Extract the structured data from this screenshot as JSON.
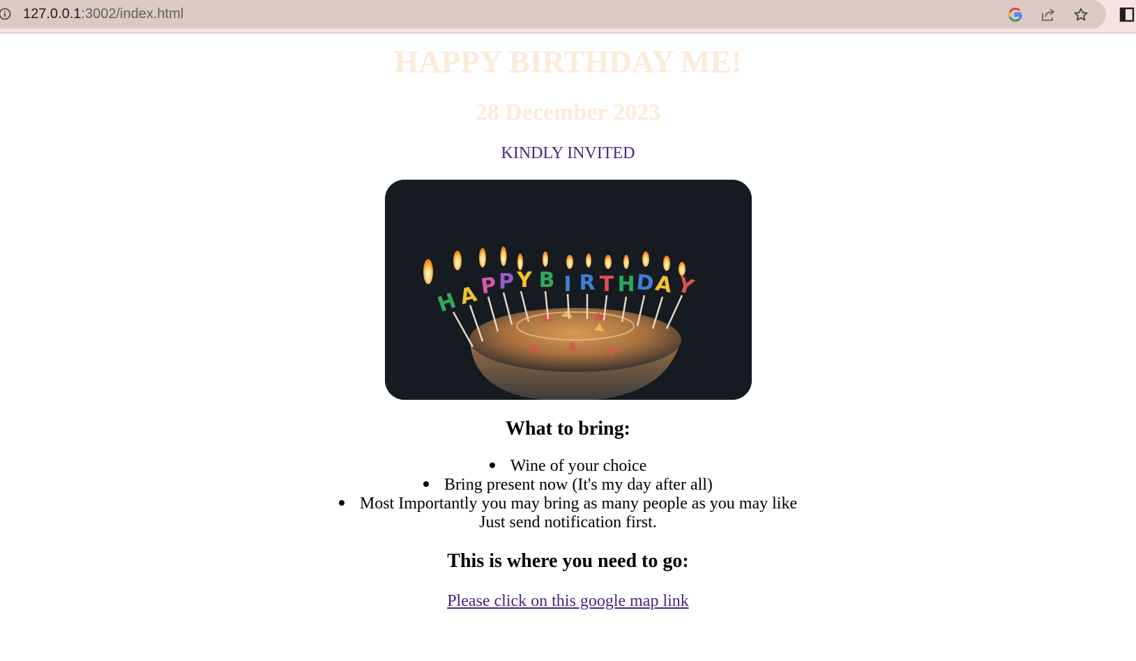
{
  "browser": {
    "url_host": "127.0.0.1",
    "url_path": ":3002/index.html",
    "icons": [
      "info-icon",
      "google-icon",
      "share-icon",
      "star-icon",
      "side-panel-icon"
    ]
  },
  "page": {
    "title": "HAPPY BIRTHDAY ME!",
    "date": "28 December 2023",
    "invite": "KINDLY INVITED",
    "bring_heading": "What to bring:",
    "bring_items": [
      "Wine of your choice",
      "Bring present now (It's my day after all)",
      "Most Importantly you may bring as many people as you may like"
    ],
    "note": "Just send notification first.",
    "where_heading": "This is where you need to go:",
    "map_link": "Please click on this google map link"
  },
  "colors": {
    "title": "#fbebd9",
    "accent": "#4a2381",
    "chrome_bg": "#f6e4e0",
    "omnibox_bg": "#dcc8c4"
  }
}
